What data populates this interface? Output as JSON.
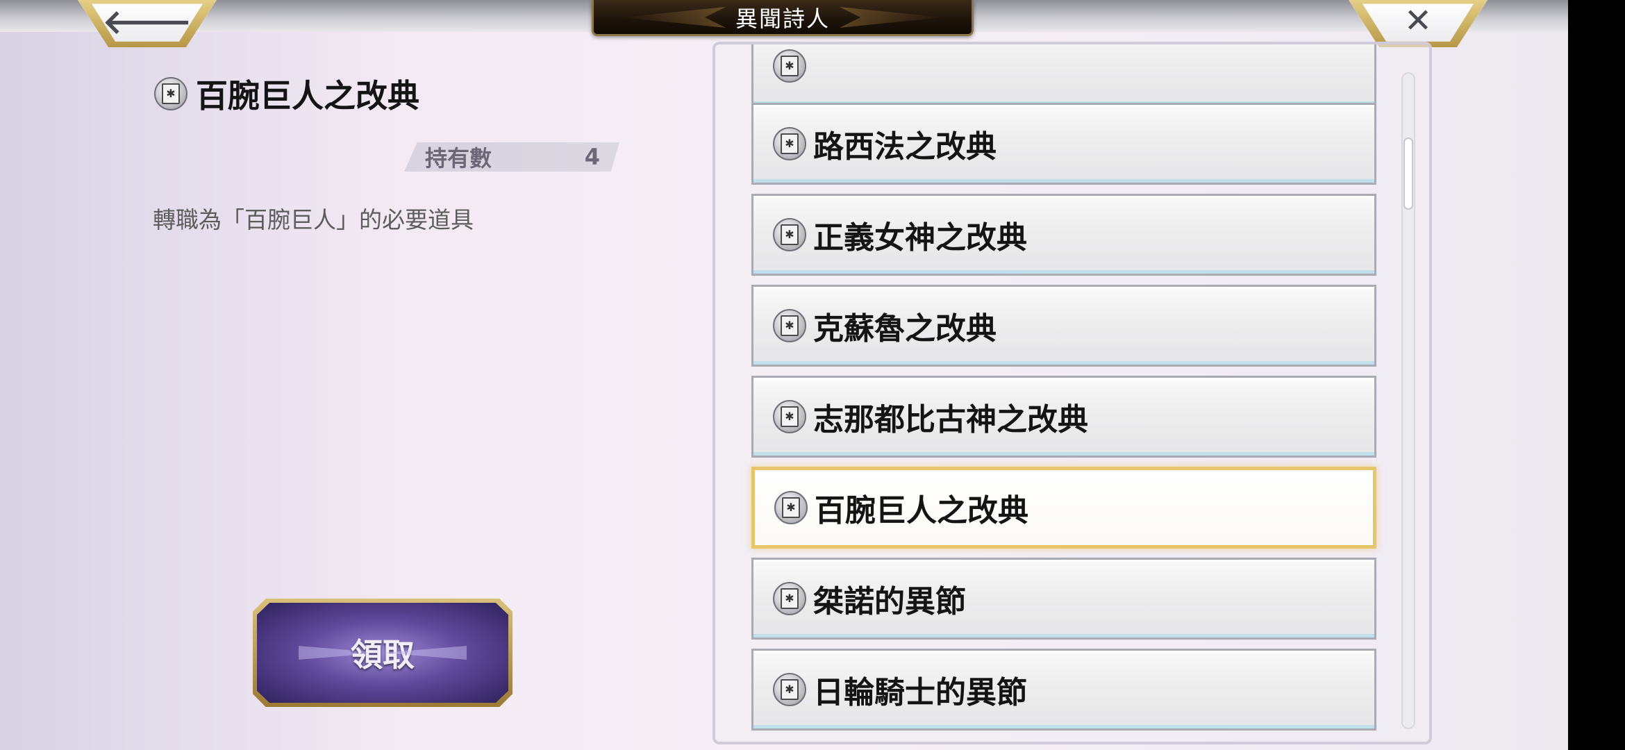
{
  "header": {
    "title": "異聞詩人",
    "back_icon": "arrow-left-icon",
    "close_icon": "close-x-icon",
    "back_glyph": "🡐",
    "close_glyph": "✕"
  },
  "detail": {
    "item_name": "百腕巨人之改典",
    "count_label": "持有數",
    "count_value": "4",
    "description": "轉職為「百腕巨人」的必要道具",
    "receive_button": "領取"
  },
  "list": {
    "items": [
      {
        "label": "",
        "selected": false
      },
      {
        "label": "路西法之改典",
        "selected": false
      },
      {
        "label": "正義女神之改典",
        "selected": false
      },
      {
        "label": "克蘇魯之改典",
        "selected": false
      },
      {
        "label": "志那都比古神之改典",
        "selected": false
      },
      {
        "label": "百腕巨人之改典",
        "selected": true
      },
      {
        "label": "桀諾的異節",
        "selected": false
      },
      {
        "label": "日輪騎士的異節",
        "selected": false
      }
    ]
  },
  "colors": {
    "selected_border": "#e8c46a",
    "receive_button": "#5f4a9c",
    "title_plate": "#1c130a"
  }
}
